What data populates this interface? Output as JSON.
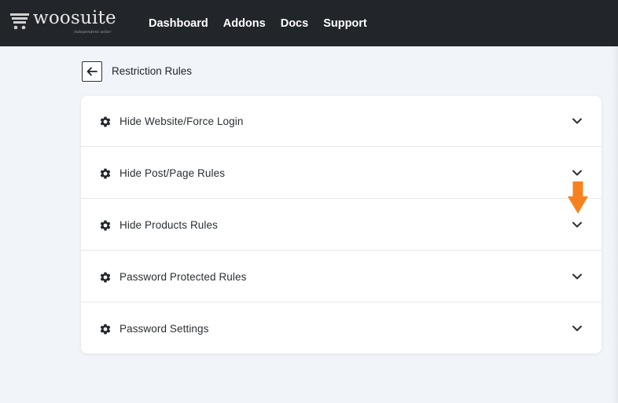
{
  "header": {
    "logo_text": "woosuite",
    "logo_tagline": "independent seller",
    "nav": [
      "Dashboard",
      "Addons",
      "Docs",
      "Support"
    ]
  },
  "page": {
    "title": "Restriction Rules"
  },
  "rules": [
    {
      "label": "Hide Website/Force Login"
    },
    {
      "label": "Hide Post/Page Rules"
    },
    {
      "label": "Hide Products Rules"
    },
    {
      "label": "Password Protected Rules"
    },
    {
      "label": "Password Settings"
    }
  ],
  "colors": {
    "topbar": "#22262b",
    "background": "#f1f4f8",
    "annotation_arrow": "#f6821f"
  },
  "icons": {
    "back": "arrow-left-icon",
    "row": "gear-icon",
    "expand": "chevron-down-icon"
  }
}
